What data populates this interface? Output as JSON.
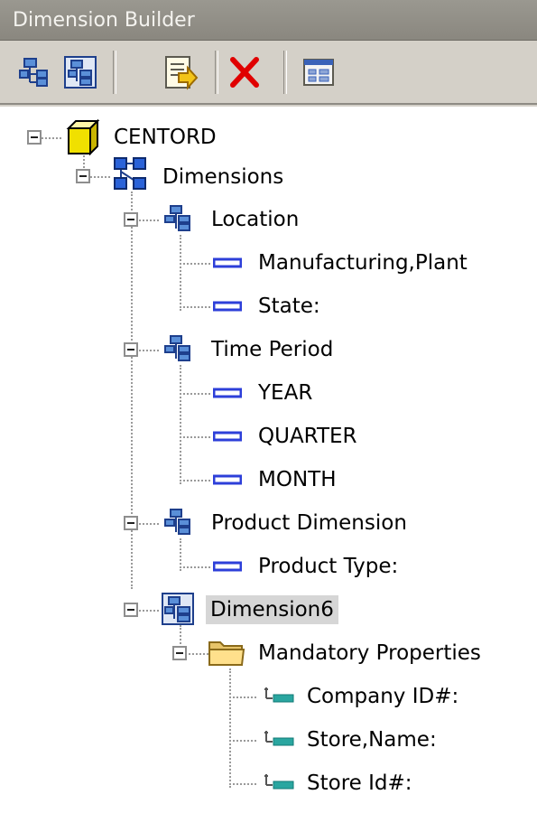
{
  "window": {
    "title": "Dimension Builder"
  },
  "toolbar": {
    "buttons": [
      {
        "name": "new-hierarchy-icon"
      },
      {
        "name": "new-dimension-icon"
      },
      {
        "name": "properties-icon"
      },
      {
        "name": "delete-icon"
      },
      {
        "name": "dialog-icon"
      }
    ]
  },
  "tree": {
    "root": {
      "label": "CENTORD",
      "icon": "cube-icon"
    },
    "dimensions": {
      "label": "Dimensions",
      "icon": "network-icon"
    },
    "location": {
      "label": "Location",
      "levels": [
        "Manufacturing,Plant",
        "State:"
      ]
    },
    "time_period": {
      "label": "Time Period",
      "levels": [
        "YEAR",
        "QUARTER",
        "MONTH"
      ]
    },
    "product_dimension": {
      "label": "Product Dimension",
      "levels": [
        "Product Type:"
      ]
    },
    "dimension6": {
      "label": "Dimension6",
      "selected": true,
      "folder": {
        "label": "Mandatory Properties",
        "icon": "folder-icon",
        "properties": [
          "Company ID#:",
          "Store,Name:",
          "Store Id#:"
        ]
      }
    }
  }
}
